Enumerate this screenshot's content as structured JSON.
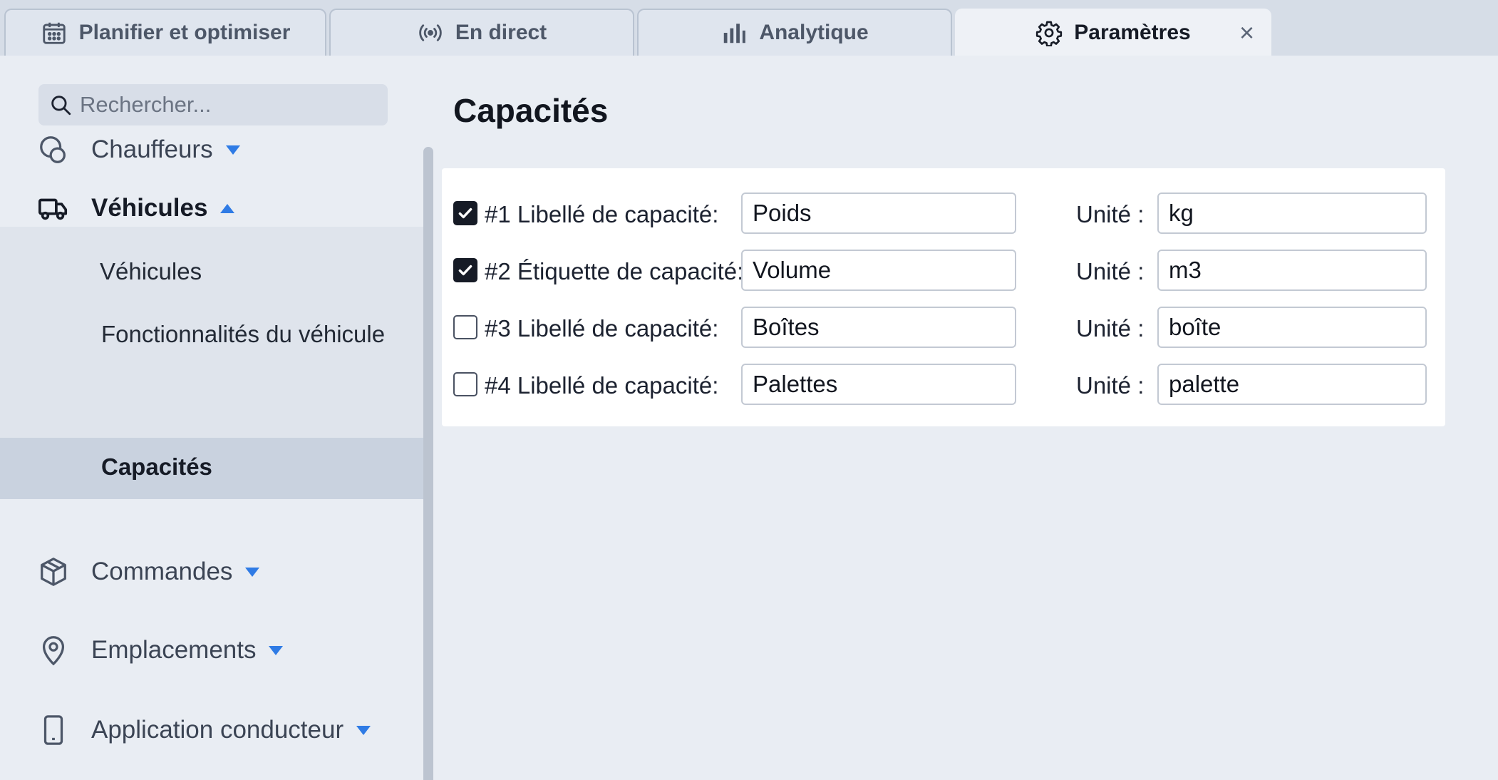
{
  "tabs": [
    {
      "label": "Planifier et optimiser",
      "icon": "calendar-icon",
      "active": false
    },
    {
      "label": "En direct",
      "icon": "broadcast-icon",
      "active": false
    },
    {
      "label": "Analytique",
      "icon": "bar-chart-icon",
      "active": false
    },
    {
      "label": "Paramètres",
      "icon": "gear-icon",
      "active": true,
      "close": "×"
    }
  ],
  "sidebar": {
    "search_placeholder": "Rechercher...",
    "items": [
      {
        "label": "Chauffeurs",
        "icon": "driver-icon",
        "expanded": false
      },
      {
        "label": "Véhicules",
        "icon": "truck-icon",
        "expanded": true
      },
      {
        "label": "Commandes",
        "icon": "package-icon",
        "expanded": false
      },
      {
        "label": "Emplacements",
        "icon": "location-pin-icon",
        "expanded": false
      },
      {
        "label": "Application conducteur",
        "icon": "phone-icon",
        "expanded": false
      }
    ],
    "vehicle_subitems": [
      {
        "label": "Véhicules",
        "selected": false
      },
      {
        "label": "Fonctionnalités du véhicule",
        "selected": false
      },
      {
        "label": "Capacités",
        "selected": true
      }
    ]
  },
  "main": {
    "title": "Capacités",
    "unit_label": "Unité :",
    "rows": [
      {
        "checked": true,
        "label": "#1 Libellé de capacité:",
        "value": "Poids",
        "unit": "kg"
      },
      {
        "checked": true,
        "label": "#2 Étiquette de capacité:",
        "value": "Volume",
        "unit": "m3"
      },
      {
        "checked": false,
        "label": "#3 Libellé de capacité:",
        "value": "Boîtes",
        "unit": "boîte"
      },
      {
        "checked": false,
        "label": "#4 Libellé de capacité:",
        "value": "Palettes",
        "unit": "palette"
      }
    ]
  },
  "colors": {
    "accent": "#2f7be5",
    "background": "#e9edf3",
    "tab_bar": "#d6dde7",
    "selected_item": "#c9d2df"
  }
}
